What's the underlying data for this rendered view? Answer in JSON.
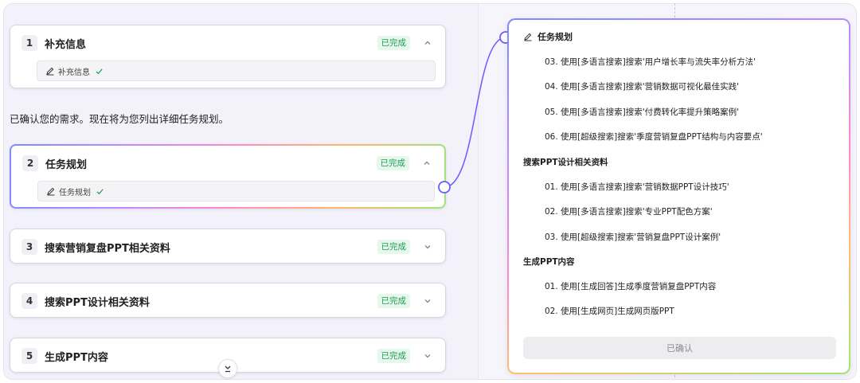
{
  "steps": [
    {
      "num": "1",
      "title": "补充信息",
      "status": "已完成",
      "sub": "补充信息"
    },
    {
      "num": "2",
      "title": "任务规划",
      "status": "已完成",
      "sub": "任务规划"
    },
    {
      "num": "3",
      "title": "搜索营销复盘PPT相关资料",
      "status": "已完成"
    },
    {
      "num": "4",
      "title": "搜索PPT设计相关资料",
      "status": "已完成"
    },
    {
      "num": "5",
      "title": "生成PPT内容",
      "status": "已完成"
    }
  ],
  "confirm_text": "已确认您的需求。现在将为您列出详细任务规划。",
  "plan": {
    "title": "任务规划",
    "items_a": [
      "03.   使用[多语言搜索]搜索'用户增长率与流失率分析方法'",
      "04.   使用[多语言搜索]搜索'营销数据可视化最佳实践'",
      "05.   使用[多语言搜索]搜索'付费转化率提升策略案例'",
      "06.   使用[超级搜索]搜索'季度营销复盘PPT结构与内容要点'"
    ],
    "section_b": "搜索PPT设计相关资料",
    "items_b": [
      "01.   使用[多语言搜索]搜索'营销数据PPT设计技巧'",
      "02.   使用[多语言搜索]搜索'专业PPT配色方案'",
      "03.   使用[超级搜索]搜索'营销复盘PPT设计案例'"
    ],
    "section_c": "生成PPT内容",
    "items_c": [
      "01.   使用[生成回答]生成季度营销复盘PPT内容",
      "02.   使用[生成网页]生成网页版PPT"
    ],
    "confirm_button": "已确认"
  },
  "colors": {
    "badge_text": "#1f9d55",
    "badge_bg": "#e6f7ec",
    "accent": "#6a5cff"
  },
  "icons": [
    "pencil-icon",
    "check-icon",
    "chevron-up-icon",
    "chevron-down-icon",
    "double-chevron-down-icon"
  ]
}
